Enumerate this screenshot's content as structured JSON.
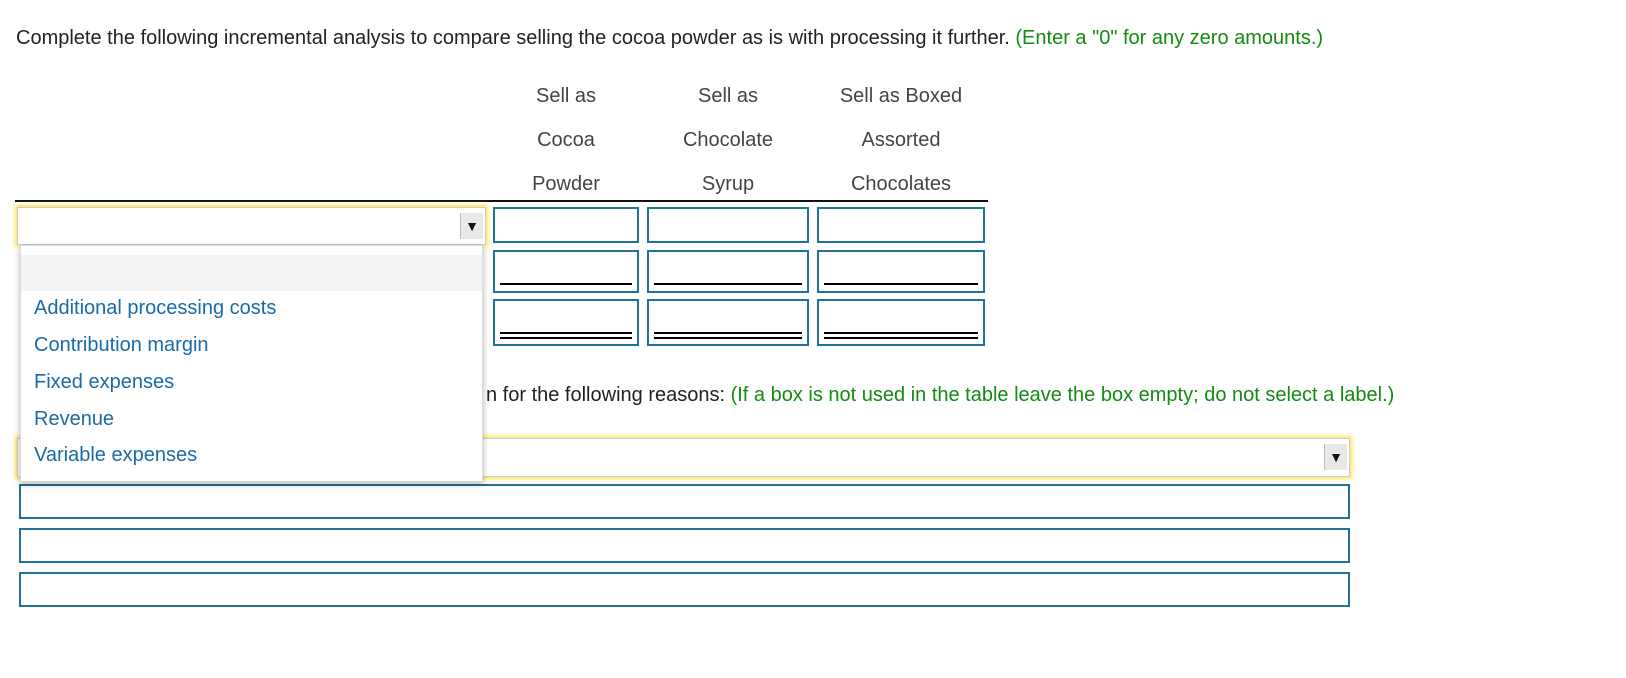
{
  "instruction": {
    "text": "Complete the following incremental analysis to compare selling the cocoa powder as is with processing it further.",
    "hint": "(Enter a \"0\" for any zero amounts.)"
  },
  "columns": [
    {
      "lines": [
        "Sell as",
        "Cocoa",
        "Powder"
      ]
    },
    {
      "lines": [
        "Sell as",
        "Chocolate",
        "Syrup"
      ]
    },
    {
      "lines": [
        "Sell as Boxed",
        "Assorted",
        "Chocolates"
      ]
    }
  ],
  "dropdown": {
    "options": [
      "",
      "Additional processing costs",
      "Contribution margin",
      "Fixed expenses",
      "Revenue",
      "Variable expenses"
    ],
    "arrow": "▼"
  },
  "reasons": {
    "text": "n for the following reasons:",
    "hint": "(If a box is not used in the table leave the box empty; do not select a label.)"
  },
  "colors": {
    "accent": "#1f7197",
    "hint": "#138a13",
    "option": "#1a6aa8",
    "focus": "#fde45a"
  }
}
